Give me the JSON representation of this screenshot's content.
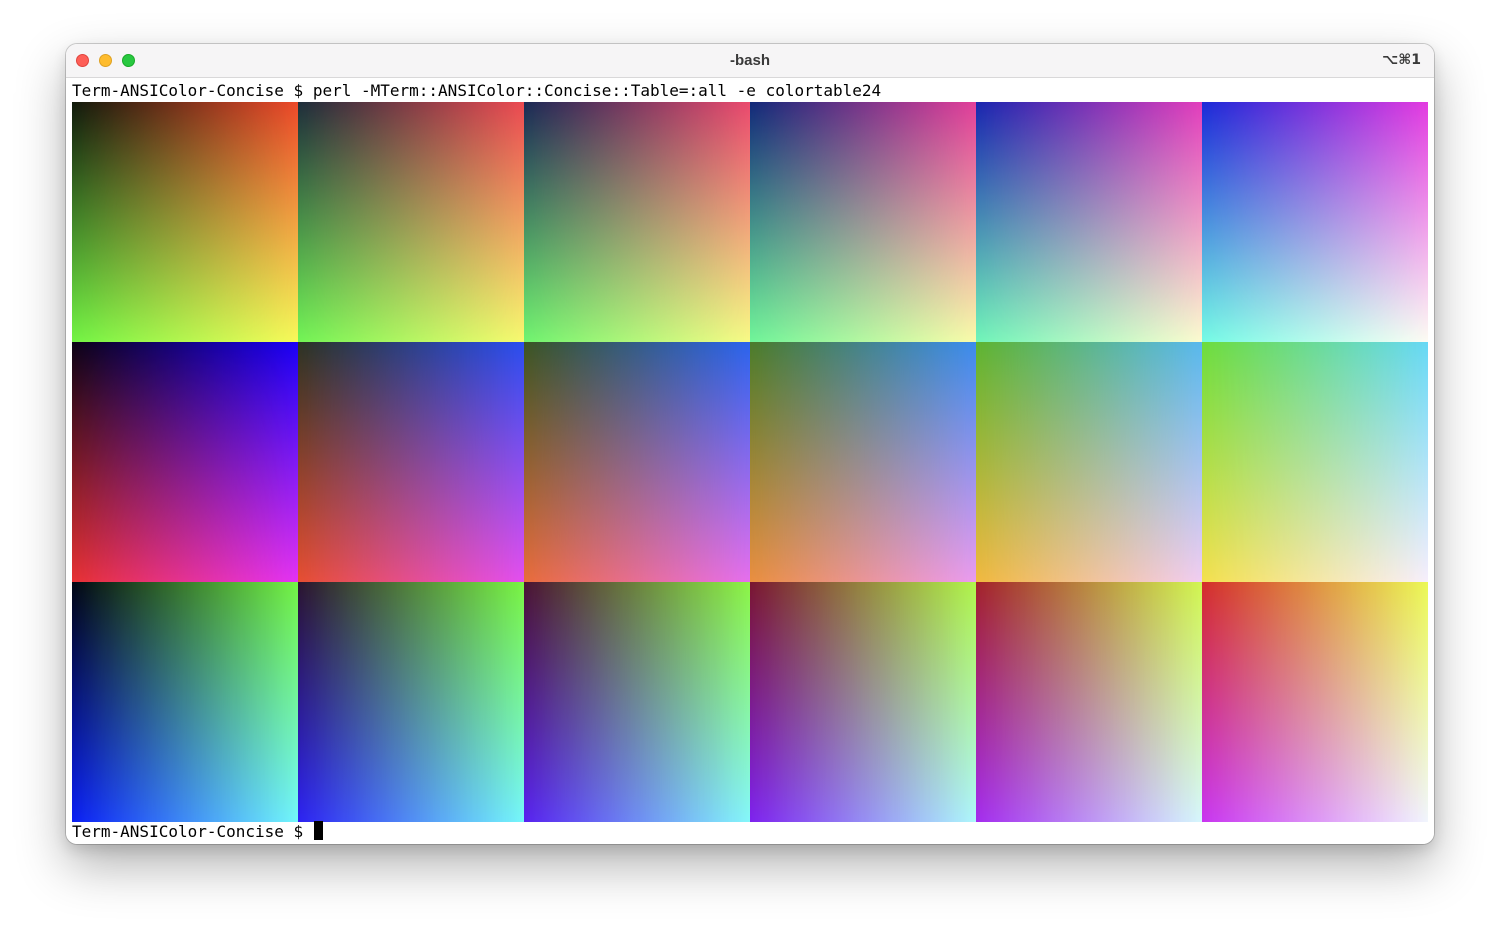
{
  "window": {
    "title": "-bash",
    "shortcut": "⌥⌘1"
  },
  "terminal": {
    "command_line": "Term-ANSIColor-Concise $ perl -MTerm::ANSIColor::Concise::Table=:all -e colortable24",
    "prompt": "Term-ANSIColor-Concise $ "
  },
  "colortable": {
    "rows": [
      {
        "axis": "top-left → top-right: red varies, bottom-left: green varies",
        "blocks": [
          {
            "tl": "#101a0c",
            "tr": "#ee4a2a",
            "bl": "#72f445",
            "br": "#f8f95a"
          },
          {
            "tl": "#1d2e3b",
            "tr": "#ed4a52",
            "bl": "#72f456",
            "br": "#f8f970"
          },
          {
            "tl": "#1b2a56",
            "tr": "#ec4a6e",
            "bl": "#70f470",
            "br": "#f8fa86"
          },
          {
            "tl": "#122a7a",
            "tr": "#e33f9a",
            "bl": "#70f599",
            "br": "#fafbaa"
          },
          {
            "tl": "#1926b0",
            "tr": "#e33ebc",
            "bl": "#70f5b9",
            "br": "#fcfbcf"
          },
          {
            "tl": "#1b2ad8",
            "tr": "#e43be0",
            "bl": "#75fbe5",
            "br": "#fdfcf3"
          }
        ]
      },
      {
        "axis": "top-right: blue, bottom-left: red",
        "blocks": [
          {
            "tl": "#0c0315",
            "tr": "#1b00f7",
            "bl": "#e73232",
            "br": "#e333f5"
          },
          {
            "tl": "#2c3323",
            "tr": "#2a4ef0",
            "bl": "#e74f31",
            "br": "#e34ff0"
          },
          {
            "tl": "#3b5524",
            "tr": "#2b64ee",
            "bl": "#e96d3b",
            "br": "#e56fee"
          },
          {
            "tl": "#4b7c2b",
            "tr": "#3b8cee",
            "bl": "#ea8f3f",
            "br": "#ea9bf0"
          },
          {
            "tl": "#5eb431",
            "tr": "#58b8ee",
            "bl": "#f1b93e",
            "br": "#f1cdf2"
          },
          {
            "tl": "#6ddd3d",
            "tr": "#66d8f6",
            "bl": "#f4e04d",
            "br": "#f7eefc"
          }
        ]
      },
      {
        "axis": "top-right: green, bottom-left: blue",
        "blocks": [
          {
            "tl": "#020614",
            "tr": "#73f445",
            "bl": "#0b1ef3",
            "br": "#73f8fb"
          },
          {
            "tl": "#2b1430",
            "tr": "#79f543",
            "bl": "#2d22f2",
            "br": "#76f8fa"
          },
          {
            "tl": "#4b1333",
            "tr": "#8cf546",
            "bl": "#5822ef",
            "br": "#85f8fa"
          },
          {
            "tl": "#7a1631",
            "tr": "#b0f64b",
            "bl": "#7e22ee",
            "br": "#aef8fb"
          },
          {
            "tl": "#a3212b",
            "tr": "#d1f751",
            "bl": "#a42cee",
            "br": "#d6f8fc"
          },
          {
            "tl": "#d42d2b",
            "tr": "#ebf955",
            "bl": "#c935f0",
            "br": "#f1f6fd"
          }
        ]
      }
    ]
  }
}
